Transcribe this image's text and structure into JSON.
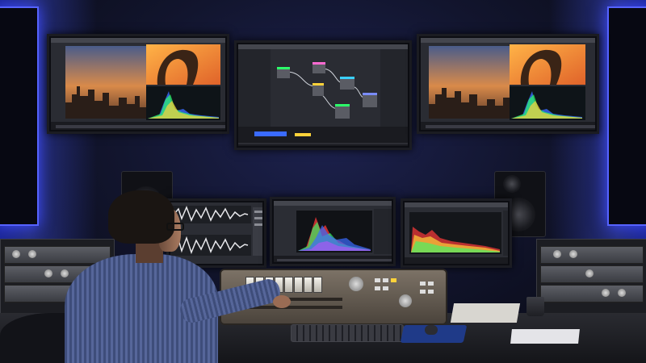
{
  "scene": {
    "description_labels": {},
    "colors": {
      "ambient_light": "#3f4cff",
      "wall": "#12152e",
      "histogram_red": "#ff3a3a",
      "histogram_green": "#2cff6a",
      "histogram_blue": "#3a6bff",
      "histogram_yellow": "#ffd23a",
      "console_body": "#7c7266"
    },
    "monitors": [
      {
        "name": "left-top-monitor",
        "content": "city-sunset-and-arch-grading"
      },
      {
        "name": "center-top-monitor",
        "content": "node-graph-editor"
      },
      {
        "name": "right-top-monitor",
        "content": "city-sunset-and-arch-grading"
      },
      {
        "name": "left-desk-monitor",
        "content": "audio-waveforms"
      },
      {
        "name": "center-desk-monitor",
        "content": "rgb-histogram-scope"
      },
      {
        "name": "right-desk-monitor",
        "content": "rgb-histogram-scope"
      }
    ],
    "icons": {
      "mixing_console": "mixing-console-icon",
      "keyboard": "keyboard-icon",
      "mouse": "mouse-icon",
      "mug": "mug-icon",
      "speaker": "speaker-icon"
    }
  }
}
